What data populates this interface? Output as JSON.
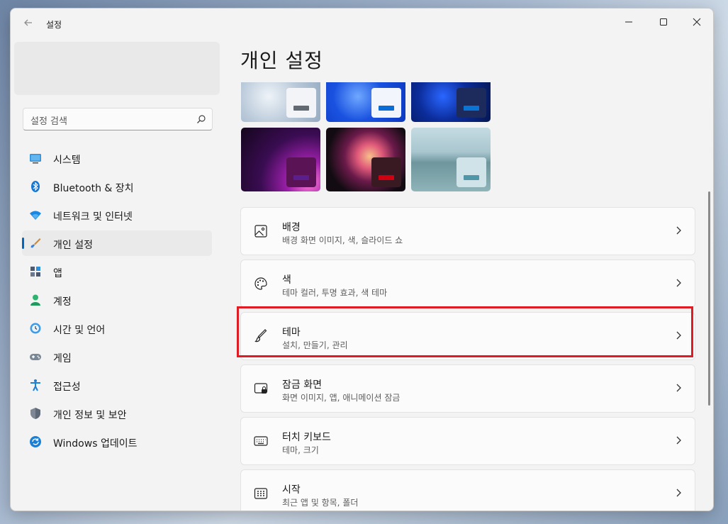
{
  "app": {
    "title": "설정",
    "back_icon": "arrow-left-icon"
  },
  "window_controls": {
    "minimize": "minimize-icon",
    "maximize": "maximize-icon",
    "close": "close-icon"
  },
  "search": {
    "placeholder": "설정 검색",
    "icon": "search-icon"
  },
  "sidebar": {
    "active_index": 3,
    "items": [
      {
        "label": "시스템",
        "icon": "monitor-icon"
      },
      {
        "label": "Bluetooth & 장치",
        "icon": "bluetooth-icon"
      },
      {
        "label": "네트워크 및 인터넷",
        "icon": "wifi-icon"
      },
      {
        "label": "개인 설정",
        "icon": "paintbrush-icon"
      },
      {
        "label": "앱",
        "icon": "apps-icon"
      },
      {
        "label": "계정",
        "icon": "person-icon"
      },
      {
        "label": "시간 및 언어",
        "icon": "clock-globe-icon"
      },
      {
        "label": "게임",
        "icon": "gamepad-icon"
      },
      {
        "label": "접근성",
        "icon": "accessibility-icon"
      },
      {
        "label": "개인 정보 및 보안",
        "icon": "shield-icon"
      },
      {
        "label": "Windows 업데이트",
        "icon": "update-icon"
      }
    ]
  },
  "page": {
    "title": "개인 설정"
  },
  "themes": [
    {
      "name": "windows-light",
      "colors": [
        "#c9d6e3",
        "#8fa6bf"
      ],
      "chip": "#f2f4f7",
      "bar": "#616a73"
    },
    {
      "name": "windows-bloom-light",
      "colors": [
        "#0a3ad6",
        "#4f8cff"
      ],
      "chip": "#f2f5fb",
      "bar": "#0a6cd6"
    },
    {
      "name": "windows-bloom-dark",
      "colors": [
        "#04123f",
        "#0c49d6"
      ],
      "chip": "#1c2b5c",
      "bar": "#0a73d6"
    },
    {
      "name": "glow",
      "colors": [
        "#190824",
        "#9a1fa8"
      ],
      "chip": "#5a1455",
      "bar": "#5a1f8c"
    },
    {
      "name": "captured-motion",
      "colors": [
        "#120c12",
        "#d0365a"
      ],
      "chip": "#3a1a22",
      "bar": "#d00010"
    },
    {
      "name": "flow",
      "colors": [
        "#a9c6cf",
        "#5f8a90"
      ],
      "chip": "#cfe3e8",
      "bar": "#4f97a8"
    }
  ],
  "cards": [
    {
      "title": "배경",
      "subtitle": "배경 화면 이미지, 색, 슬라이드 쇼",
      "icon": "image-icon"
    },
    {
      "title": "색",
      "subtitle": "테마 컬러, 투명 효과, 색 테마",
      "icon": "palette-icon"
    },
    {
      "title": "테마",
      "subtitle": "설치, 만들기, 관리",
      "icon": "brush-icon",
      "highlighted": true
    },
    {
      "title": "잠금 화면",
      "subtitle": "화면 이미지, 앱, 애니메이션 잠금",
      "icon": "lock-screen-icon"
    },
    {
      "title": "터치 키보드",
      "subtitle": "테마, 크기",
      "icon": "keyboard-icon"
    },
    {
      "title": "시작",
      "subtitle": "최근 앱 및 항목, 폴더",
      "icon": "start-icon"
    }
  ],
  "colors": {
    "accent": "#0067c0",
    "highlight": "#e01b24"
  }
}
